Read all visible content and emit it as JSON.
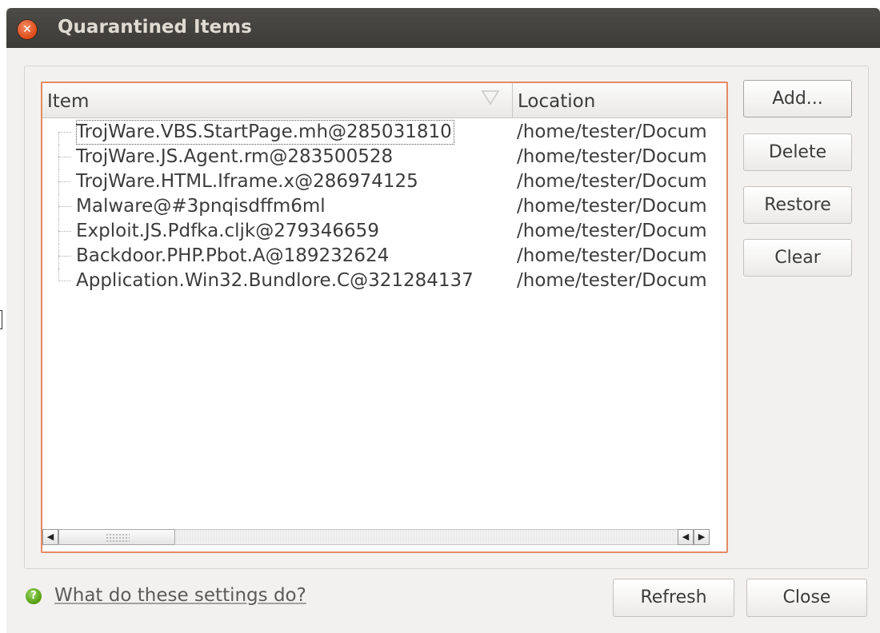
{
  "window": {
    "title": "Quarantined Items",
    "close_icon": "close-icon"
  },
  "tree": {
    "columns": [
      "Item",
      "Location"
    ],
    "sort_icon": "sort-indicator-icon",
    "rows": [
      {
        "item": "TrojWare.VBS.StartPage.mh@285031810",
        "location": "/home/tester/Docum"
      },
      {
        "item": "TrojWare.JS.Agent.rm@283500528",
        "location": "/home/tester/Docum"
      },
      {
        "item": "TrojWare.HTML.Iframe.x@286974125",
        "location": "/home/tester/Docum"
      },
      {
        "item": "Malware@#3pnqisdffm6ml",
        "location": "/home/tester/Docum"
      },
      {
        "item": "Exploit.JS.Pdfka.cljk@279346659",
        "location": "/home/tester/Docum"
      },
      {
        "item": "Backdoor.PHP.Pbot.A@189232624",
        "location": "/home/tester/Docum"
      },
      {
        "item": "Application.Win32.Bundlore.C@321284137",
        "location": "/home/tester/Docum"
      }
    ],
    "scroll_left_icon": "◀",
    "scroll_right_icon": "▶"
  },
  "side_buttons": {
    "add": "Add...",
    "delete": "Delete",
    "restore": "Restore",
    "clear": "Clear"
  },
  "footer": {
    "help_icon": "help-icon",
    "help_link": "What do these settings do?",
    "refresh": "Refresh",
    "close": "Close"
  },
  "colors": {
    "titlebar": "#3c3b37",
    "focus_border": "#e58a61",
    "close_button": "#df4a16",
    "help_icon": "#4e9a06"
  }
}
